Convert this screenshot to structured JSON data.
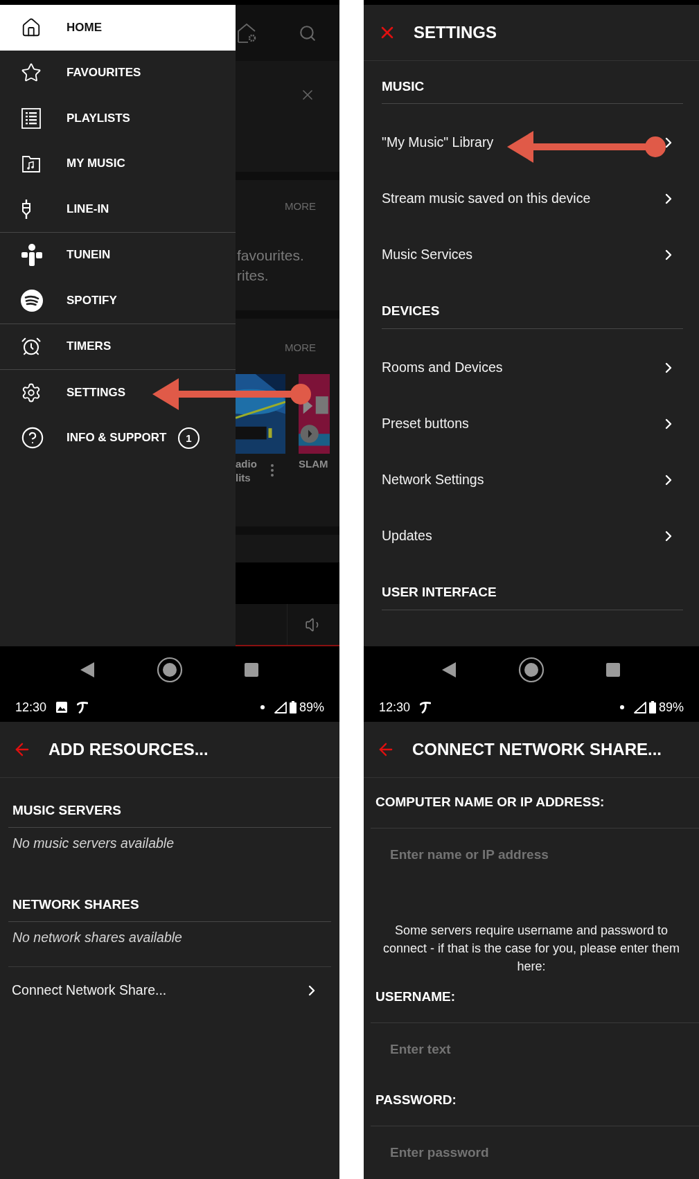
{
  "menu_screen": {
    "groups": [
      {
        "items": [
          {
            "label": "HOME",
            "selected": true
          },
          {
            "label": "FAVOURITES",
            "selected": false
          },
          {
            "label": "PLAYLISTS",
            "selected": false
          },
          {
            "label": "MY MUSIC",
            "selected": false
          },
          {
            "label": "LINE-IN",
            "selected": false
          }
        ]
      },
      {
        "items": [
          {
            "label": "TUNEIN",
            "selected": false
          },
          {
            "label": "SPOTIFY",
            "selected": false
          }
        ]
      },
      {
        "items": [
          {
            "label": "TIMERS",
            "selected": false
          }
        ]
      },
      {
        "items": [
          {
            "label": "SETTINGS",
            "selected": false
          },
          {
            "label": "INFO & SUPPORT",
            "selected": false,
            "badge": "1"
          }
        ]
      }
    ],
    "background": {
      "sections": [
        {
          "more": "MORE",
          "message_lines": [
            "favourites.",
            "rites."
          ]
        },
        {
          "more": "MORE",
          "tiles": [
            {
              "caption_lines": [
                "adio",
                "lits"
              ]
            },
            {
              "caption_lines": [
                "SLAM"
              ]
            }
          ]
        }
      ]
    }
  },
  "status_bars": [
    {
      "time": "12:30",
      "battery": "89%"
    },
    {
      "time": "12:30",
      "battery": "89%"
    }
  ],
  "settings_screen": {
    "title": "SETTINGS",
    "sections": [
      {
        "heading": "MUSIC",
        "items": [
          {
            "label": "\"My Music\" Library"
          },
          {
            "label": "Stream music saved on this device"
          },
          {
            "label": "Music Services"
          }
        ]
      },
      {
        "heading": "DEVICES",
        "items": [
          {
            "label": "Rooms and Devices"
          },
          {
            "label": "Preset buttons"
          },
          {
            "label": "Network Settings"
          },
          {
            "label": "Updates"
          }
        ]
      },
      {
        "heading": "USER INTERFACE"
      }
    ]
  },
  "add_resources_screen": {
    "title": "ADD RESOURCES...",
    "sections": [
      {
        "heading": "MUSIC SERVERS",
        "empty_text": "No music servers available"
      },
      {
        "heading": "NETWORK SHARES",
        "empty_text": "No network shares available"
      }
    ],
    "link": "Connect Network Share..."
  },
  "connect_share_screen": {
    "title": "CONNECT NETWORK SHARE...",
    "items": [
      {
        "kind": "field",
        "label": "COMPUTER NAME OR IP ADDRESS:",
        "placeholder": "Enter name or IP address"
      },
      {
        "kind": "note",
        "text": "Some servers require username and password to connect - if that is the case for you, please enter them here:"
      },
      {
        "kind": "field",
        "label": "USERNAME:",
        "placeholder": "Enter text"
      },
      {
        "kind": "field",
        "label": "PASSWORD:",
        "placeholder": "Enter password"
      }
    ]
  }
}
